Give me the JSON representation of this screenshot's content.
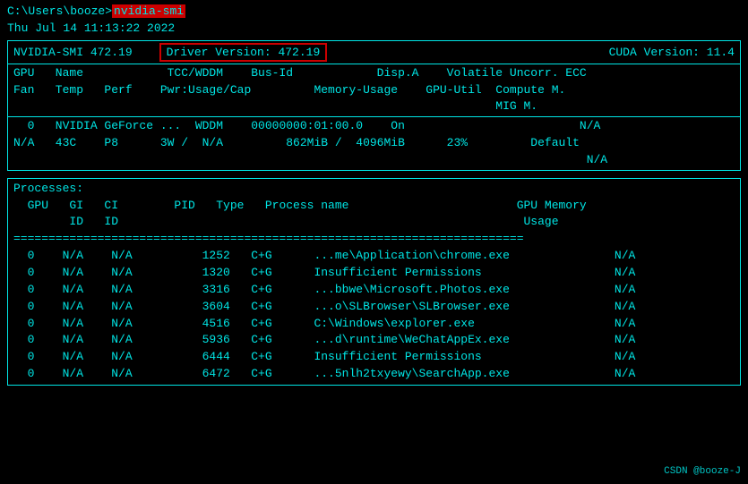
{
  "terminal": {
    "prompt": "C:\\Users\\booze>",
    "command": "nvidia-smi",
    "datetime": "Thu Jul 14 11:13:22 2022",
    "smi": {
      "version_label": "NVIDIA-SMI 472.19",
      "driver_label": "Driver Version: 472.19",
      "cuda_label": "CUDA Version: 11.4"
    },
    "col_header_row1": "GPU   Name            TCC/WDDM    Bus-Id            Disp.A    Volatile Uncorr. ECC",
    "col_header_row2": "Fan   Temp   Perf    Pwr:Usage/Cap         Memory-Usage    GPU-Util  Compute M.",
    "col_header_row3": "                                                                     MIG M.",
    "divider_equals": "=========================================================================================",
    "divider_dashes": "-----------------------------------------------------------------------------------------",
    "gpu_row1": "  0   NVIDIA GeForce ...  WDDM    00000000:01:00.0    On                         N/A",
    "gpu_row2": "N/A   43C    P8      3W /  N/A         862MiB /  4096MiB      23%         Default",
    "gpu_row3": "                                                                                  N/A",
    "processes_header": "Processes:",
    "proc_col_header": "  GPU   GI   CI        PID   Type   Process name                        GPU Memory",
    "proc_col_header2": "        ID   ID                                                          Usage",
    "proc_divider": "=========================================================================",
    "processes": [
      {
        "gpu": "0",
        "gi": "N/A",
        "ci": "N/A",
        "pid": "1252",
        "type": "C+G",
        "name": "...me\\Application\\chrome.exe",
        "mem": "N/A"
      },
      {
        "gpu": "0",
        "gi": "N/A",
        "ci": "N/A",
        "pid": "1320",
        "type": "C+G",
        "name": "Insufficient Permissions",
        "mem": "N/A"
      },
      {
        "gpu": "0",
        "gi": "N/A",
        "ci": "N/A",
        "pid": "3316",
        "type": "C+G",
        "name": "...bbwe\\Microsoft.Photos.exe",
        "mem": "N/A"
      },
      {
        "gpu": "0",
        "gi": "N/A",
        "ci": "N/A",
        "pid": "3604",
        "type": "C+G",
        "name": "...o\\SLBrowser\\SLBrowser.exe",
        "mem": "N/A"
      },
      {
        "gpu": "0",
        "gi": "N/A",
        "ci": "N/A",
        "pid": "4516",
        "type": "C+G",
        "name": "C:\\Windows\\explorer.exe",
        "mem": "N/A"
      },
      {
        "gpu": "0",
        "gi": "N/A",
        "ci": "N/A",
        "pid": "5936",
        "type": "C+G",
        "name": "...d\\runtime\\WeChatAppEx.exe",
        "mem": "N/A"
      },
      {
        "gpu": "0",
        "gi": "N/A",
        "ci": "N/A",
        "pid": "6444",
        "type": "C+G",
        "name": "Insufficient Permissions",
        "mem": "N/A"
      },
      {
        "gpu": "0",
        "gi": "N/A",
        "ci": "N/A",
        "pid": "6472",
        "type": "C+G",
        "name": "...5nlh2txyewy\\SearchApp.exe",
        "mem": "N/A"
      }
    ],
    "watermark": "CSDN @booze-J"
  }
}
